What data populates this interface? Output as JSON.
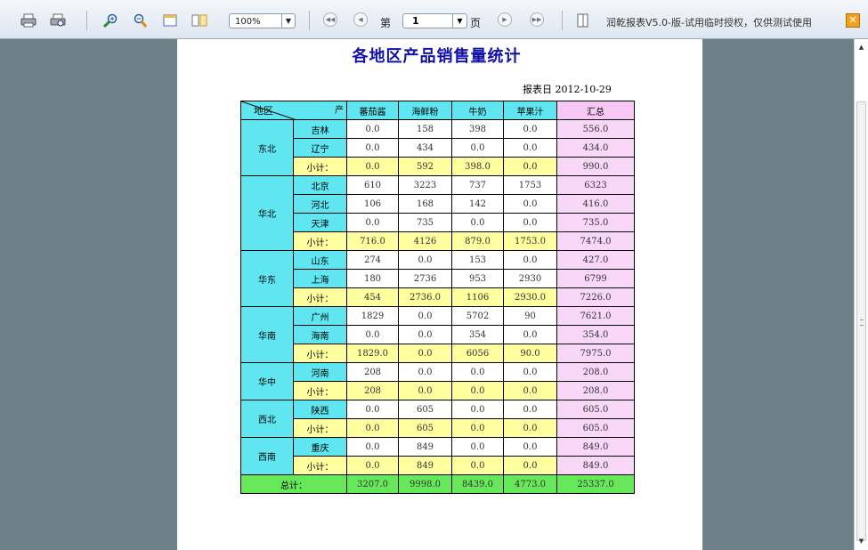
{
  "toolbar": {
    "icons": [
      "print-icon",
      "print-preview-icon",
      "zoom-in-icon",
      "zoom-out-icon",
      "page-width-icon",
      "two-page-icon"
    ],
    "zoom_value": "100%",
    "page_label_before": "第",
    "page_value": "1",
    "page_label_after": "页",
    "license_text": "润乾报表V5.0-版-试用临时授权，仅供测试使用"
  },
  "report": {
    "title": "各地区产品销售量统计",
    "date_label": "报表日",
    "date_value": "2012-10-29",
    "corner_top": "产",
    "corner_bottom": "地区",
    "columns": [
      "蕃茄酱",
      "海鲜粉",
      "牛奶",
      "苹果汁",
      "汇总"
    ],
    "regions": [
      {
        "name": "东北",
        "rows": [
          {
            "city": "吉林",
            "values": [
              "0.0",
              "158",
              "398",
              "0.0",
              "556.0"
            ]
          },
          {
            "city": "辽宁",
            "values": [
              "0.0",
              "434",
              "0.0",
              "0.0",
              "434.0"
            ]
          },
          {
            "city": "小计：",
            "subtotal": true,
            "values": [
              "0.0",
              "592",
              "398.0",
              "0.0",
              "990.0"
            ]
          }
        ]
      },
      {
        "name": "华北",
        "rows": [
          {
            "city": "北京",
            "values": [
              "610",
              "3223",
              "737",
              "1753",
              "6323"
            ]
          },
          {
            "city": "河北",
            "values": [
              "106",
              "168",
              "142",
              "0.0",
              "416.0"
            ]
          },
          {
            "city": "天津",
            "values": [
              "0.0",
              "735",
              "0.0",
              "0.0",
              "735.0"
            ]
          },
          {
            "city": "小计：",
            "subtotal": true,
            "values": [
              "716.0",
              "4126",
              "879.0",
              "1753.0",
              "7474.0"
            ]
          }
        ]
      },
      {
        "name": "华东",
        "rows": [
          {
            "city": "山东",
            "values": [
              "274",
              "0.0",
              "153",
              "0.0",
              "427.0"
            ]
          },
          {
            "city": "上海",
            "values": [
              "180",
              "2736",
              "953",
              "2930",
              "6799"
            ]
          },
          {
            "city": "小计：",
            "subtotal": true,
            "values": [
              "454",
              "2736.0",
              "1106",
              "2930.0",
              "7226.0"
            ]
          }
        ]
      },
      {
        "name": "华南",
        "rows": [
          {
            "city": "广州",
            "values": [
              "1829",
              "0.0",
              "5702",
              "90",
              "7621.0"
            ]
          },
          {
            "city": "海南",
            "values": [
              "0.0",
              "0.0",
              "354",
              "0.0",
              "354.0"
            ]
          },
          {
            "city": "小计：",
            "subtotal": true,
            "values": [
              "1829.0",
              "0.0",
              "6056",
              "90.0",
              "7975.0"
            ]
          }
        ]
      },
      {
        "name": "华中",
        "rows": [
          {
            "city": "河南",
            "values": [
              "208",
              "0.0",
              "0.0",
              "0.0",
              "208.0"
            ]
          },
          {
            "city": "小计：",
            "subtotal": true,
            "values": [
              "208",
              "0.0",
              "0.0",
              "0.0",
              "208.0"
            ]
          }
        ]
      },
      {
        "name": "西北",
        "rows": [
          {
            "city": "陕西",
            "values": [
              "0.0",
              "605",
              "0.0",
              "0.0",
              "605.0"
            ]
          },
          {
            "city": "小计：",
            "subtotal": true,
            "values": [
              "0.0",
              "605",
              "0.0",
              "0.0",
              "605.0"
            ]
          }
        ]
      },
      {
        "name": "西南",
        "rows": [
          {
            "city": "重庆",
            "values": [
              "0.0",
              "849",
              "0.0",
              "0.0",
              "849.0"
            ]
          },
          {
            "city": "小计：",
            "subtotal": true,
            "values": [
              "0.0",
              "849",
              "0.0",
              "0.0",
              "849.0"
            ]
          }
        ]
      }
    ],
    "total": {
      "label": "总计：",
      "values": [
        "3207.0",
        "9998.0",
        "8439.0",
        "4773.0",
        "25337.0"
      ]
    }
  },
  "colors": {
    "header": "#5fe6f0",
    "summary_header": "#f6c8f3",
    "subtotal": "#ffffa0",
    "summary": "#f9d7f8",
    "total": "#66e85a",
    "title": "#1111aa",
    "background": "#6e8189"
  }
}
